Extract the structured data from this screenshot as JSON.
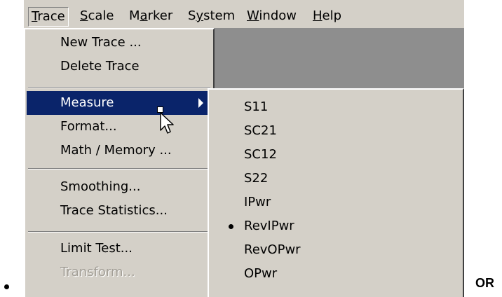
{
  "menubar": {
    "items": [
      {
        "label": "Trace",
        "accel": "T",
        "open": true
      },
      {
        "label": "Scale",
        "accel": "S"
      },
      {
        "label": "Marker",
        "accel": "a"
      },
      {
        "label": "System",
        "accel": "y"
      },
      {
        "label": "Window",
        "accel": "W"
      },
      {
        "label": "Help",
        "accel": "H"
      }
    ]
  },
  "trace_menu": {
    "new_trace": "New Trace ...",
    "delete_trace": "Delete Trace",
    "measure": "Measure",
    "format": "Format...",
    "math_memory": "Math / Memory ...",
    "smoothing": "Smoothing...",
    "trace_statistics": "Trace Statistics...",
    "limit_test": "Limit Test...",
    "transform": "Transform..."
  },
  "measure_submenu": {
    "items": [
      "S11",
      "SC21",
      "SC12",
      "S22",
      "IPwr",
      "RevIPwr",
      "RevOPwr",
      "OPwr"
    ],
    "checked": "RevIPwr"
  },
  "or_label": "OR",
  "colors": {
    "menu_bg": "#d4d0c8",
    "highlight_bg": "#0a246a",
    "highlight_text": "#ffffff",
    "disabled_text": "#a29e96",
    "background_area": "#808080"
  },
  "icons": [
    "submenu-arrow-icon",
    "mouse-pointer-icon",
    "radio-bullet-icon",
    "list-bullet-icon"
  ]
}
